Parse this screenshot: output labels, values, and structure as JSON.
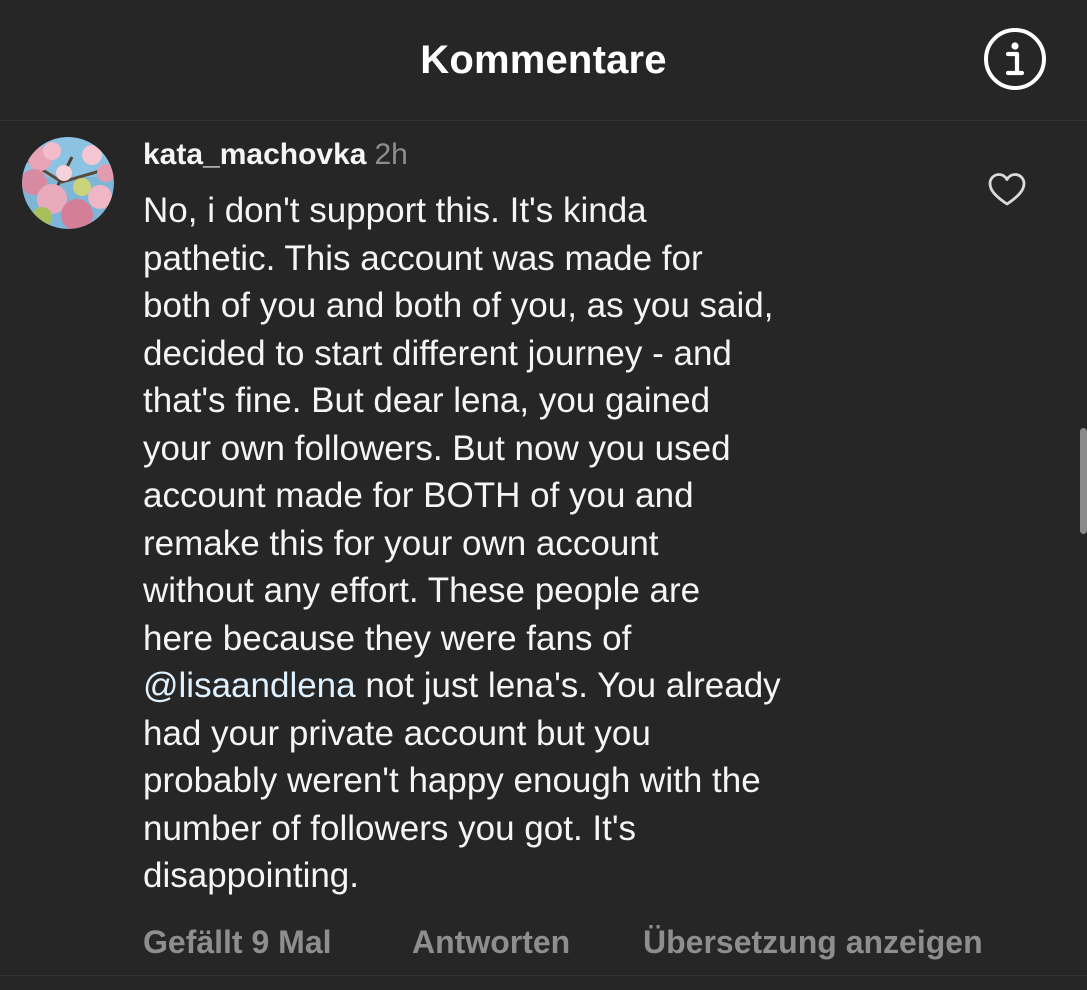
{
  "header": {
    "title": "Kommentare",
    "info_icon": "info-circle-icon"
  },
  "comment": {
    "avatar_icon": "profile-avatar",
    "username": "kata_machovka",
    "time": "2h",
    "text_before_mention": "No, i don't support this. It's kinda\npathetic. This account was made for\nboth of you and both of you, as you said,\ndecided to start different journey - and\nthat's fine. But dear lena, you gained\nyour own followers. But now you used\naccount made for BOTH of you and\nremake this for your own account\nwithout any effort. These people are\nhere because they were fans of\n",
    "mention": "@lisaandlena",
    "text_after_mention": " not just lena's. You already\nhad your private account but you\nprobably weren't happy enough with the\nnumber of followers you got. It's\ndisappointing.",
    "like_icon": "heart-outline-icon",
    "likes_label": "Gefällt 9 Mal",
    "reply_label": "Antworten",
    "translate_label": "Übersetzung anzeigen"
  },
  "colors": {
    "background": "#262626",
    "text_primary": "#f5f5f5",
    "text_secondary": "#8e8e8e",
    "mention": "#e0f1ff"
  }
}
